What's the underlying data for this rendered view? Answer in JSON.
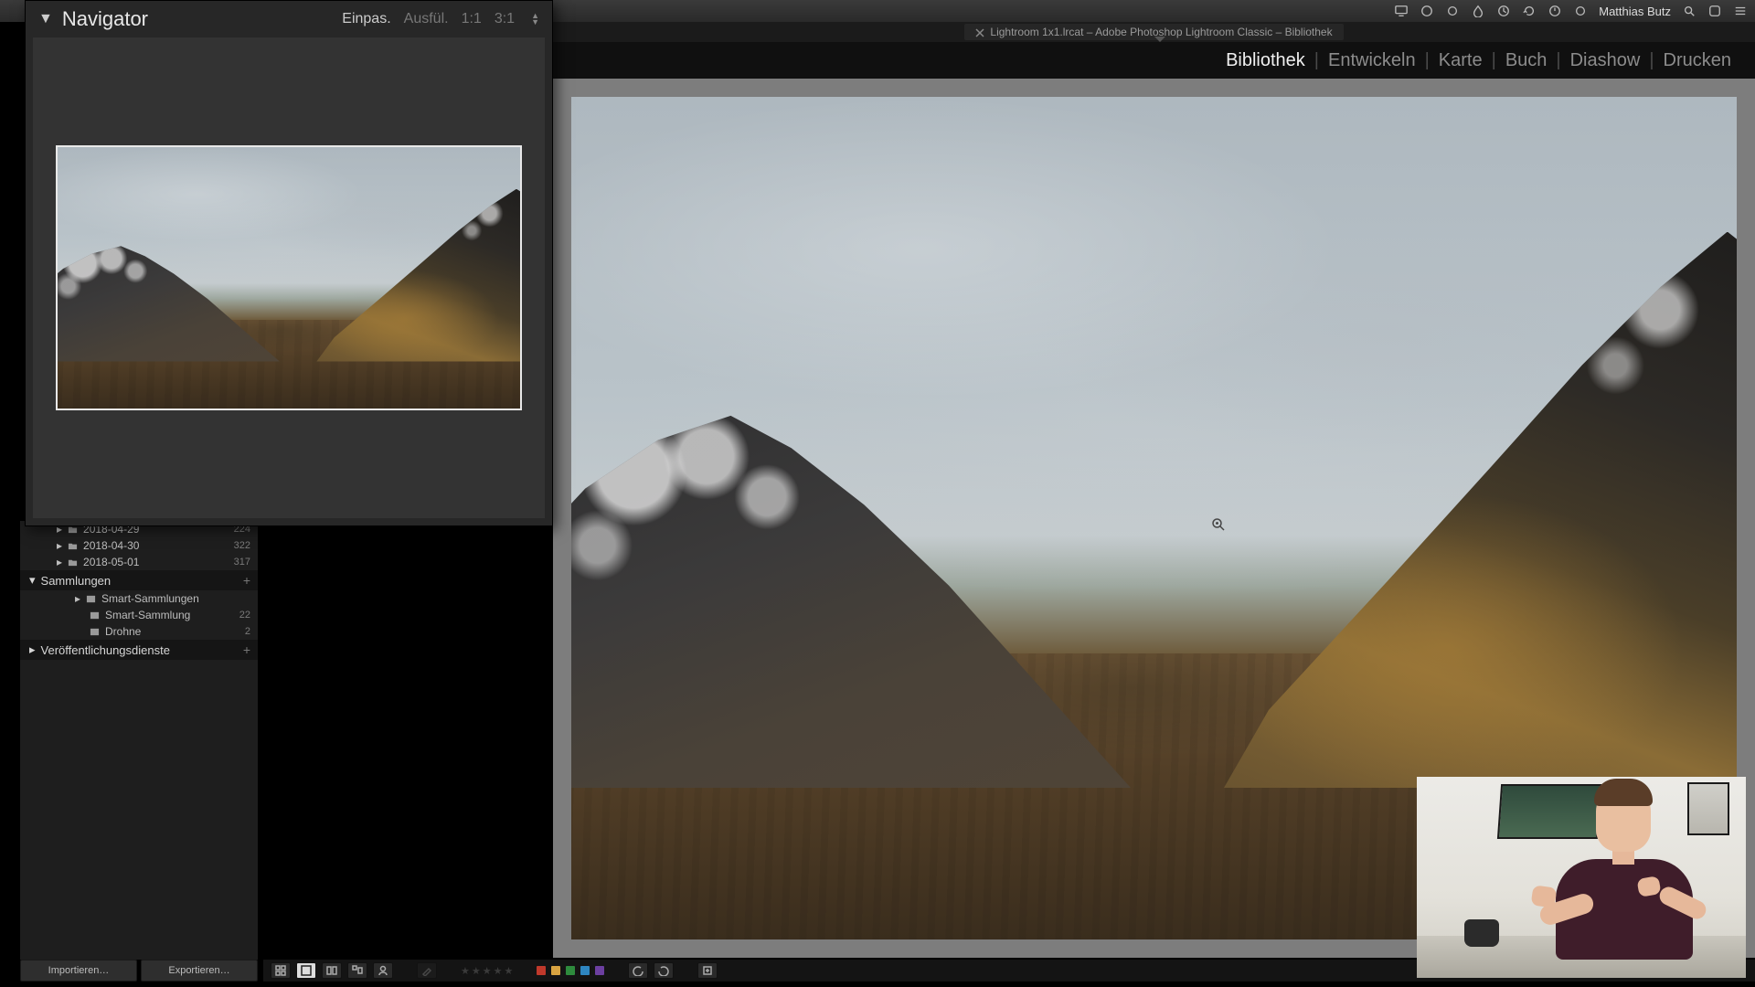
{
  "mac": {
    "user": "Matthias Butz"
  },
  "doc_tab": {
    "title": "Lightroom 1x1.lrcat – Adobe Photoshop Lightroom Classic – Bibliothek"
  },
  "modules": {
    "items": [
      "Bibliothek",
      "Entwickeln",
      "Karte",
      "Buch",
      "Diashow",
      "Drucken"
    ],
    "active_index": 0
  },
  "navigator": {
    "title": "Navigator",
    "zoom": {
      "fit": "Einpas.",
      "fill": "Ausfül.",
      "one": "1:1",
      "ratio": "3:1"
    }
  },
  "folders": [
    {
      "name": "2018-04-29",
      "count": "224"
    },
    {
      "name": "2018-04-30",
      "count": "322"
    },
    {
      "name": "2018-05-01",
      "count": "317"
    }
  ],
  "collections": {
    "title": "Sammlungen",
    "items": [
      {
        "name": "Smart-Sammlungen",
        "count": "",
        "indent": 1
      },
      {
        "name": "Smart-Sammlung",
        "count": "22",
        "indent": 2
      },
      {
        "name": "Drohne",
        "count": "2",
        "indent": 2
      }
    ]
  },
  "publish": {
    "title": "Veröffentlichungsdienste"
  },
  "buttons": {
    "import": "Importieren…",
    "export": "Exportieren…"
  },
  "colors": {
    "swatches": [
      "#c0392b",
      "#d9a441",
      "#2e8b3d",
      "#2e86c1",
      "#6c3fa0"
    ]
  }
}
